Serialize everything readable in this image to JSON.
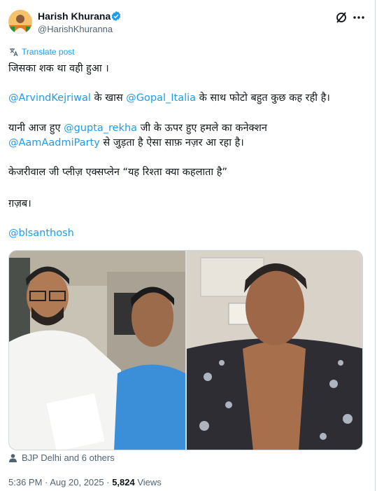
{
  "author": {
    "name": "Harish Khurana",
    "handle": "@HarishKhuranna",
    "verified_color": "#1d9bf0",
    "avatar_icon": "profile-avatar"
  },
  "translate_label": "Translate post",
  "tweet": {
    "line1": "जिसका शक था वही हुआ ।",
    "p2": {
      "mention_a": "@ArvindKejriwal",
      "mid": " के खास ",
      "mention_b": "@Gopal_Italia",
      "tail": " के साथ फोटो बहुत कुछ कह रही है।"
    },
    "p3a": {
      "head": "यानी आज हुए ",
      "mention": "@gupta_rekha",
      "tail": " जी के ऊपर हुए हमले का कनेक्शन"
    },
    "p3b": {
      "mention": "@AamAadmiParty",
      "tail": " से जुड़ता है ऐसा साफ़ नज़र आ रहा है।"
    },
    "p4": "केजरीवाल जी प्लीज़ एक्सप्लेन “यह रिश्ता क्या कहलाता है”",
    "p5": "ग़ज़ब।",
    "p6_mention": "@blsanthosh"
  },
  "likers_text": "BJP Delhi and 6 others",
  "meta": {
    "time": "5:36 PM",
    "sep1": " · ",
    "date": "Aug 20, 2025",
    "sep2": " · ",
    "views_count": "5,824",
    "views_label": " Views"
  },
  "colors": {
    "link": "#1d9bf0",
    "secondary": "#536471",
    "text": "#0f1419"
  }
}
